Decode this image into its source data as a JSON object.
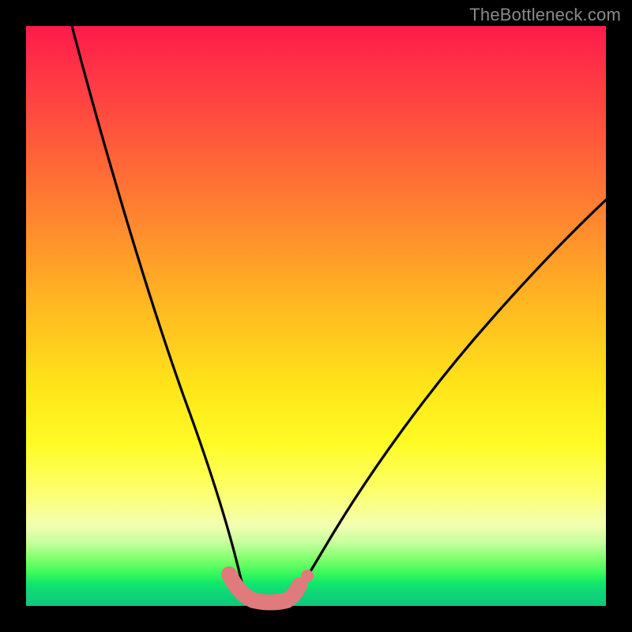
{
  "watermark": "TheBottleneck.com",
  "chart_data": {
    "type": "line",
    "title": "",
    "xlabel": "",
    "ylabel": "",
    "xlim": [
      0,
      100
    ],
    "ylim": [
      0,
      100
    ],
    "series": [
      {
        "name": "left-curve",
        "x": [
          8,
          12,
          16,
          20,
          24,
          27,
          30,
          32,
          34,
          35.5,
          37
        ],
        "y": [
          100,
          84,
          68,
          52,
          37,
          26,
          17,
          11,
          6,
          3,
          1.5
        ]
      },
      {
        "name": "right-curve",
        "x": [
          45,
          48,
          52,
          57,
          63,
          70,
          78,
          87,
          96,
          100
        ],
        "y": [
          1.5,
          4,
          9,
          16,
          25,
          35,
          46,
          57,
          67,
          71
        ]
      },
      {
        "name": "bottom-pink-band",
        "x": [
          34,
          36,
          38,
          40,
          42,
          44,
          46
        ],
        "y": [
          4,
          2,
          1.2,
          1,
          1.2,
          2,
          4
        ]
      }
    ],
    "colors": {
      "curve": "#000000",
      "pink_band": "#e07a7d",
      "gradient_top": "#ff1a4b",
      "gradient_mid": "#ffe419",
      "gradient_bottom": "#10c77b"
    }
  }
}
